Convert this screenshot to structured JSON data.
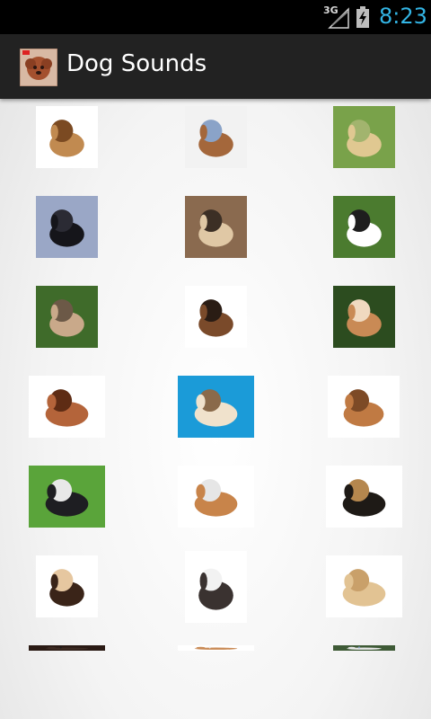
{
  "status_bar": {
    "network": "3G",
    "time": "8:23"
  },
  "action_bar": {
    "title": "Dog Sounds",
    "icon": "poodle-app-icon"
  },
  "grid": {
    "items": [
      {
        "name": "dog-image-1",
        "palette": [
          "#ffffff",
          "#c18a50",
          "#7b4a22"
        ]
      },
      {
        "name": "dog-image-2",
        "palette": [
          "#f2f2f2",
          "#a4673b",
          "#8aa3c8"
        ]
      },
      {
        "name": "dog-image-3",
        "palette": [
          "#79a24a",
          "#e0c891",
          "#a2b46e"
        ]
      },
      {
        "name": "dog-image-4",
        "palette": [
          "#9aa7c6",
          "#15151a",
          "#2b2b34"
        ]
      },
      {
        "name": "dog-image-5",
        "palette": [
          "#8a6a4f",
          "#e0c8a5",
          "#3c2f25"
        ]
      },
      {
        "name": "dog-image-6",
        "palette": [
          "#4b7b2f",
          "#ffffff",
          "#1e1e1e"
        ]
      },
      {
        "name": "dog-image-7",
        "palette": [
          "#3f6b2a",
          "#c9a98a",
          "#6c5947"
        ]
      },
      {
        "name": "dog-image-8",
        "palette": [
          "#ffffff",
          "#7a4a2a",
          "#2a1c14"
        ]
      },
      {
        "name": "dog-image-9",
        "palette": [
          "#2c4c1f",
          "#c98a55",
          "#f0d9c0"
        ]
      },
      {
        "name": "dog-image-10",
        "palette": [
          "#ffffff",
          "#b4643a",
          "#5e2c14"
        ]
      },
      {
        "name": "dog-image-11",
        "palette": [
          "#1b9bd8",
          "#f0e2cc",
          "#8a6a4a"
        ]
      },
      {
        "name": "dog-image-12",
        "palette": [
          "#ffffff",
          "#c07a43",
          "#7d4a26"
        ]
      },
      {
        "name": "dog-image-13",
        "palette": [
          "#5aa43a",
          "#1e1e22",
          "#e8e8e8"
        ]
      },
      {
        "name": "dog-image-14",
        "palette": [
          "#ffffff",
          "#c8844a",
          "#e6e6e6"
        ]
      },
      {
        "name": "dog-image-15",
        "palette": [
          "#ffffff",
          "#1e1a16",
          "#b5874e"
        ]
      },
      {
        "name": "dog-image-16",
        "palette": [
          "#ffffff",
          "#3a2418",
          "#e6c7a0"
        ]
      },
      {
        "name": "dog-image-17",
        "palette": [
          "#ffffff",
          "#3a3230",
          "#f2f2f2"
        ]
      },
      {
        "name": "dog-image-18",
        "palette": [
          "#ffffff",
          "#e2c393",
          "#c9a06a"
        ]
      },
      {
        "name": "dog-image-19",
        "palette": [
          "#2a1a14",
          "#3c2a22",
          "#1a1a1a"
        ]
      },
      {
        "name": "dog-image-20",
        "palette": [
          "#ffffff",
          "#c98a55",
          "#eeeeee"
        ]
      },
      {
        "name": "dog-image-21",
        "palette": [
          "#3e5a36",
          "#e8e8e8",
          "#8aa3c8"
        ]
      }
    ]
  }
}
